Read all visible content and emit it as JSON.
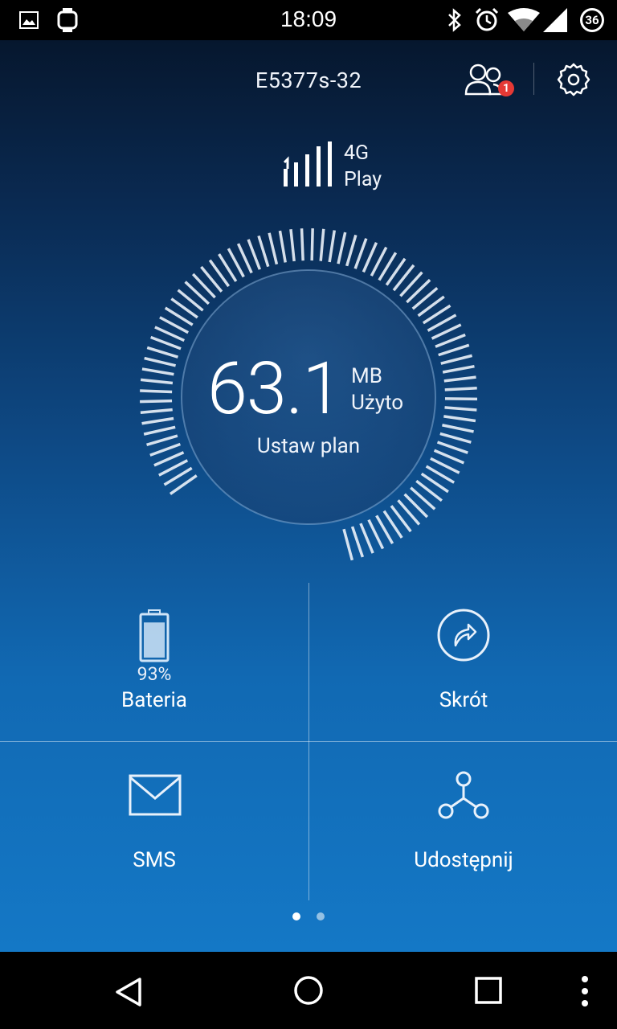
{
  "status_bar": {
    "time": "18:09",
    "battery_level": "36",
    "left_icons": [
      "image-notification-icon",
      "smartwatch-icon"
    ],
    "right_icons": [
      "bluetooth-icon",
      "alarm-icon",
      "wifi-icon",
      "cell-signal-icon",
      "battery-icon"
    ]
  },
  "header": {
    "device_name": "E5377s-32",
    "users_badge": "1"
  },
  "network": {
    "type": "4G",
    "operator": "Play"
  },
  "usage": {
    "value": "63.1",
    "unit": "MB",
    "label": "Użyto",
    "set_plan": "Ustaw plan"
  },
  "tiles": {
    "battery": {
      "percent": "93%",
      "label": "Bateria",
      "level": 0.93
    },
    "shortcut": {
      "label": "Skrót"
    },
    "sms": {
      "label": "SMS"
    },
    "share": {
      "label": "Udostępnij"
    }
  },
  "pager": {
    "pages": 2,
    "current": 1
  },
  "colors": {
    "accent": "#1478c6",
    "background_top": "#06172e"
  }
}
